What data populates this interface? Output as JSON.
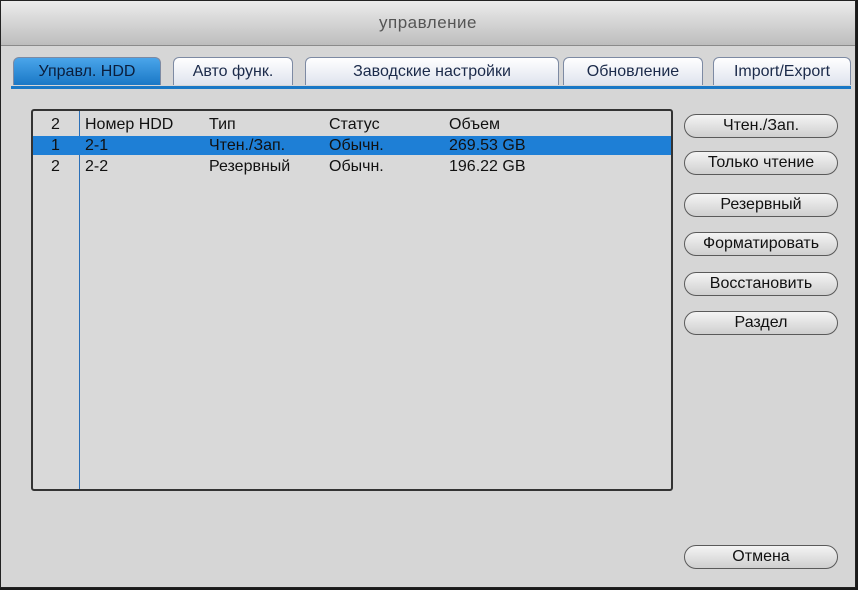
{
  "window": {
    "title": "управление"
  },
  "tabs": [
    {
      "label": "Управл. HDD",
      "active": true
    },
    {
      "label": "Авто функ."
    },
    {
      "label": "Заводские настройки"
    },
    {
      "label": "Обновление"
    },
    {
      "label": "Import/Export"
    }
  ],
  "table": {
    "count": "2",
    "headers": [
      "Номер HDD",
      "Тип",
      "Статус",
      "Объем"
    ],
    "rows": [
      {
        "index": "1",
        "hdd": "2-1",
        "type": "Чтен./Зап.",
        "status": "Обычн.",
        "size": "269.53 GB",
        "selected": true
      },
      {
        "index": "2",
        "hdd": "2-2",
        "type": "Резервный",
        "status": "Обычн.",
        "size": "196.22 GB"
      }
    ]
  },
  "buttons": {
    "read_write": "Чтен./Зап.",
    "read_only": "Только чтение",
    "backup": "Резервный",
    "format": "Форматировать",
    "restore": "Восстановить",
    "partition": "Раздел",
    "cancel": "Отмена"
  },
  "colors": {
    "accent": "#1a78c6",
    "selection": "#1e7fd6"
  }
}
